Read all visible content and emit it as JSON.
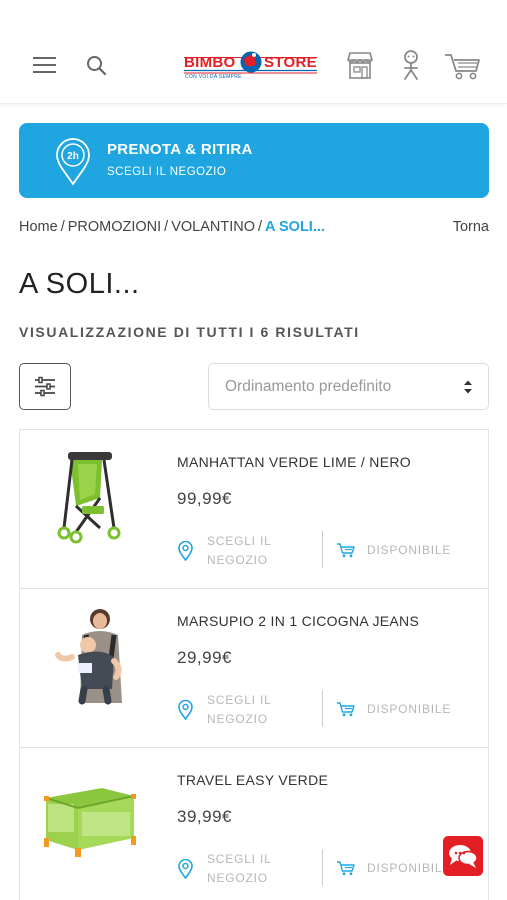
{
  "header": {
    "logo_left": "BIMBO",
    "logo_right": "STORE",
    "logo_tagline": "CON VOI DA SEMPRE"
  },
  "banner": {
    "badge": "2h",
    "title": "PRENOTA & RITIRA",
    "subtitle": "SCEGLI IL NEGOZIO"
  },
  "breadcrumb": {
    "items": [
      "Home",
      "PROMOZIONI",
      "VOLANTINO"
    ],
    "current": "A SOLI...",
    "separator": "/",
    "back_label": "Torna"
  },
  "page": {
    "title": "A SOLI...",
    "results_label": "VISUALIZZAZIONE DI TUTTI I 6 RISULTATI"
  },
  "controls": {
    "sort_label": "Ordinamento predefinito"
  },
  "products": [
    {
      "name": "MANHATTAN VERDE LIME / NERO",
      "price": "99,99€",
      "store_label": "SCEGLI IL NEGOZIO",
      "availability": "DISPONIBILE"
    },
    {
      "name": "MARSUPIO 2 IN 1 CICOGNA JEANS",
      "price": "29,99€",
      "store_label": "SCEGLI IL NEGOZIO",
      "availability": "DISPONIBILE"
    },
    {
      "name": "TRAVEL EASY VERDE",
      "price": "39,99€",
      "store_label": "SCEGLI IL NEGOZIO",
      "availability": "DISPONIBILE"
    }
  ],
  "colors": {
    "accent": "#1fa5e0",
    "brand_red": "#e31e24",
    "brand_blue": "#0066b3"
  },
  "icons": [
    "menu-icon",
    "search-icon",
    "store-icon",
    "account-icon",
    "cart-icon",
    "location-pin-icon",
    "filter-icon",
    "sort-caret-icon",
    "cart-availability-icon",
    "chat-icon"
  ]
}
